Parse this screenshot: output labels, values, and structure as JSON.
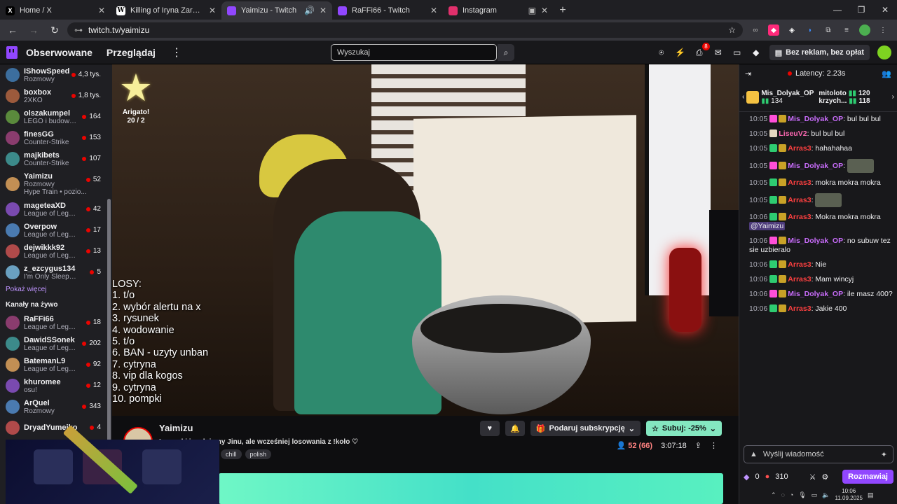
{
  "browser": {
    "tabs": [
      {
        "label": "Home / X",
        "icon": "x-logo-icon",
        "color": "#000000"
      },
      {
        "label": "Killing of Iryna Zarutska - Wikipedia",
        "icon": "wikipedia-icon",
        "color": "#ffffff"
      },
      {
        "label": "Yaimizu - Twitch",
        "icon": "twitch-icon",
        "color": "#9147ff",
        "active": true
      },
      {
        "label": "RaFFi66 - Twitch",
        "icon": "twitch-icon",
        "color": "#9147ff"
      },
      {
        "label": "Instagram",
        "icon": "instagram-icon",
        "color": "#e1306c"
      }
    ],
    "url": "twitch.tv/yaimizu"
  },
  "nav": {
    "following": "Obserwowane",
    "browse": "Przeglądaj",
    "search_placeholder": "Wyszukaj",
    "notif_count": "8",
    "adfree": "Bez reklam, bez opłat"
  },
  "sidebar": {
    "followed": [
      {
        "name": "IShowSpeed",
        "game": "Rozmowy",
        "viewers": "4,3 tys."
      },
      {
        "name": "boxbox",
        "game": "2XKO",
        "viewers": "1,8 tys."
      },
      {
        "name": "olszakumpel",
        "game": "LEGO i budowa...",
        "viewers": "164"
      },
      {
        "name": "finesGG",
        "game": "Counter-Strike",
        "viewers": "153"
      },
      {
        "name": "majkibets",
        "game": "Counter-Strike",
        "viewers": "107"
      },
      {
        "name": "Yaimizu",
        "game": "Rozmowy",
        "viewers": "52",
        "extra": "Hype Train • pozio..."
      },
      {
        "name": "mageteaXD",
        "game": "League of Lege...",
        "viewers": "42"
      },
      {
        "name": "Overpow",
        "game": "League of Lege...",
        "viewers": "17"
      },
      {
        "name": "dejwikkk92",
        "game": "League of Lege...",
        "viewers": "13"
      },
      {
        "name": "z_ezcygus134",
        "game": "I'm Only Sleeping",
        "viewers": "5"
      }
    ],
    "show_more": "Pokaż więcej",
    "live_header": "Kanały na żywo",
    "live": [
      {
        "name": "RaFFi66",
        "game": "League of Lege...",
        "viewers": "18"
      },
      {
        "name": "DawidSSonek",
        "game": "League of Lege...",
        "viewers": "202"
      },
      {
        "name": "BatemanL9",
        "game": "League of Lege...",
        "viewers": "92"
      },
      {
        "name": "khuromee",
        "game": "osu!",
        "viewers": "12"
      },
      {
        "name": "ArQuel",
        "game": "Rozmowy",
        "viewers": "343"
      },
      {
        "name": "DryadYumeiko",
        "game": "",
        "viewers": "4"
      }
    ]
  },
  "video": {
    "star_caption": "Arigato!",
    "star_count": "20 / 2",
    "losy_title": "LOSY:",
    "losy": [
      "1.  t/o",
      "2. wybór alertu na x",
      "3. rysunek",
      "4. wodowanie",
      "5. t/o",
      "6. BAN - uzyty unban",
      "7. cytryna",
      "8. vip dla kogos",
      "9. cytryna",
      "10. pompki"
    ]
  },
  "stream": {
    "name": "Yaimizu",
    "title": "Lo... ...ki i malujemy Jinu, ale wcześniej losowania z !koło ♡",
    "tags": [
      "chill",
      "polish"
    ],
    "gift": "Podaruj subskrypcję",
    "sub": "Subuj: -25%",
    "viewers": "52 (66)",
    "uptime": "3:07:18"
  },
  "chat": {
    "latency": "Latency: 2.23s",
    "leader": [
      {
        "name": "Mis_Dolyak_OP",
        "value": "134"
      },
      {
        "name": "mitoloto",
        "value": "120"
      },
      {
        "name": "krzych...",
        "value": "118"
      }
    ],
    "messages": [
      {
        "time": "10:05",
        "user": "Mis_Dolyak_OP",
        "cls": "u1",
        "text": "bul bul bul"
      },
      {
        "time": "10:05",
        "user": "LiseuV2",
        "cls": "u3",
        "text": "bul bul bul"
      },
      {
        "time": "10:05",
        "user": "Arras3",
        "cls": "u2",
        "text": "hahahahaa"
      },
      {
        "time": "10:05",
        "user": "Mis_Dolyak_OP",
        "cls": "u1",
        "text": "",
        "emote": true
      },
      {
        "time": "10:05",
        "user": "Arras3",
        "cls": "u2",
        "text": "mokra mokra mokra"
      },
      {
        "time": "10:05",
        "user": "Arras3",
        "cls": "u2",
        "text": "",
        "emote": true
      },
      {
        "time": "10:06",
        "user": "Arras3",
        "cls": "u2",
        "text": "Mokra mokra mokra",
        "mention": "@Yaimizu"
      },
      {
        "time": "10:06",
        "user": "Mis_Dolyak_OP",
        "cls": "u1",
        "text": "no subuw tez sie uzbieralo"
      },
      {
        "time": "10:06",
        "user": "Arras3",
        "cls": "u2",
        "text": "Nie"
      },
      {
        "time": "10:06",
        "user": "Arras3",
        "cls": "u2",
        "text": "Mam wincyj"
      },
      {
        "time": "10:06",
        "user": "Mis_Dolyak_OP",
        "cls": "u1",
        "text": "ile masz 400?"
      },
      {
        "time": "10:06",
        "user": "Arras3",
        "cls": "u2",
        "text": "Jakie 400"
      }
    ],
    "input_placeholder": "Wyślij wiadomość",
    "points_a": "0",
    "points_b": "310",
    "chat_button": "Rozmawiaj"
  },
  "taskbar": {
    "time": "10:06",
    "date": "11.09.2025"
  }
}
